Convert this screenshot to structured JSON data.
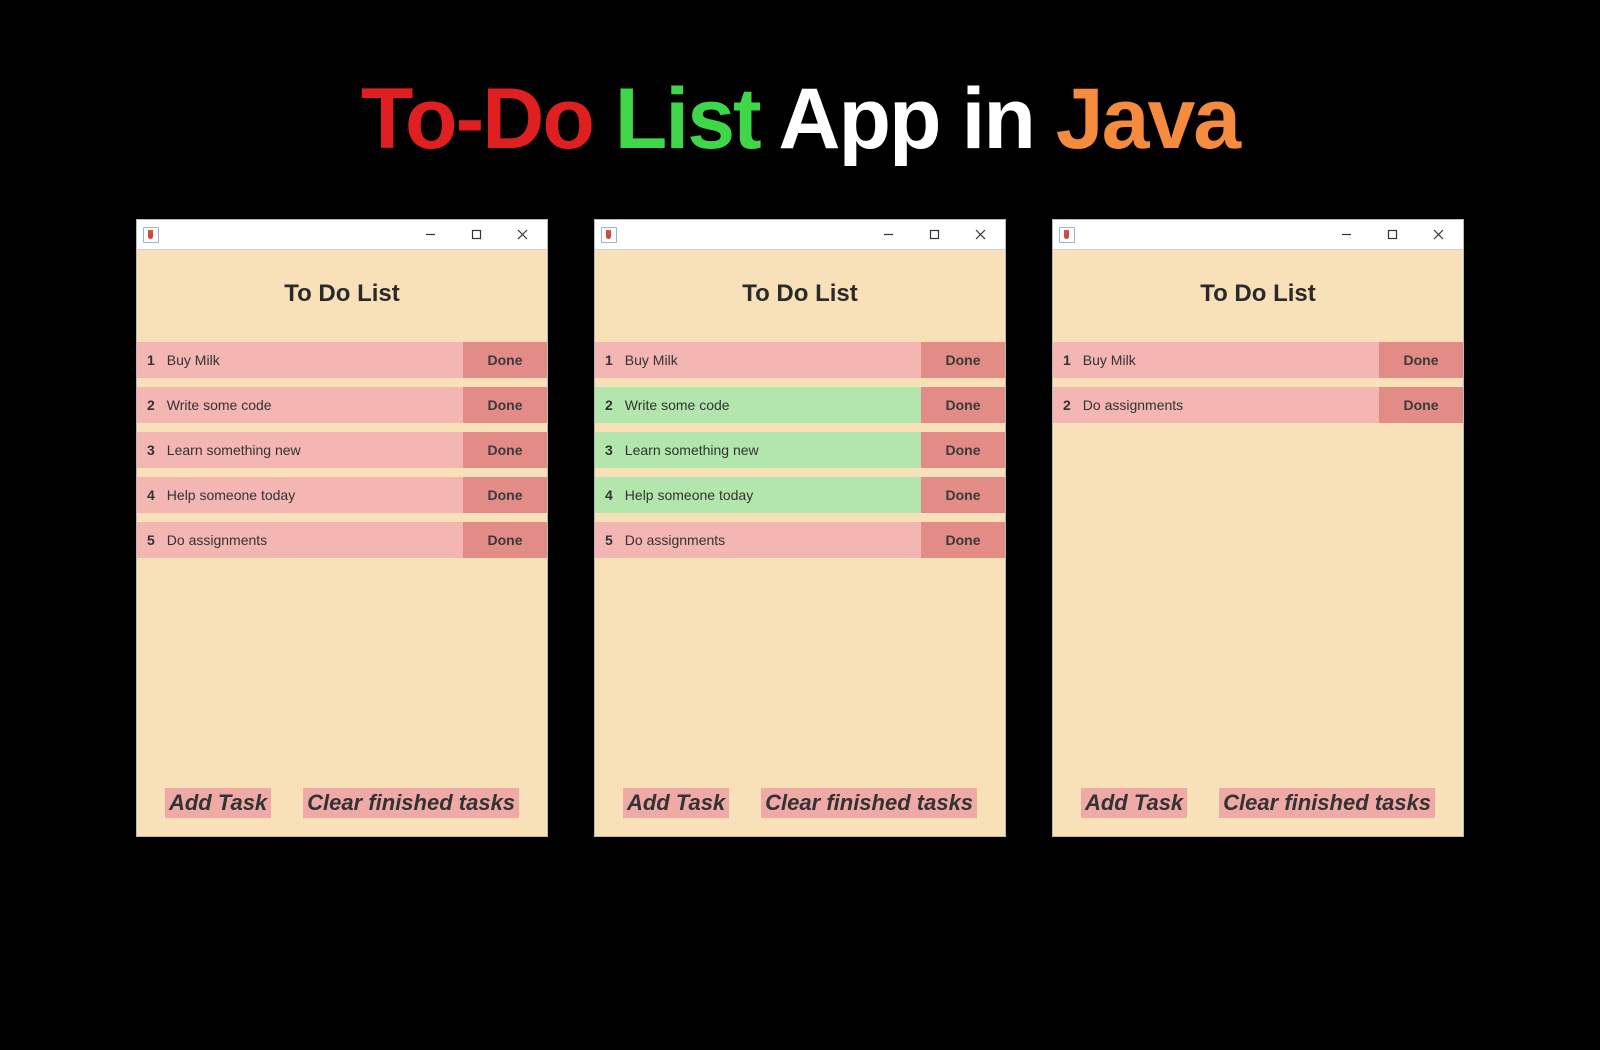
{
  "page_title": {
    "part1": "To-Do",
    "part2": "List",
    "part3": "App in",
    "part4": "Java"
  },
  "colors": {
    "task_pending": "#f3b6b3",
    "task_done_row": "#b3e6ad",
    "done_btn": "#e28b87",
    "footer_btn": "#efa9a6",
    "window_bg": "#f8e1b8"
  },
  "labels": {
    "done": "Done",
    "add_task": "Add Task",
    "clear_finished": "Clear finished tasks",
    "app_title": "To Do List"
  },
  "windows": {
    "left": {
      "title": "To Do List",
      "tasks": [
        {
          "num": "1",
          "text": "Buy Milk",
          "state": "pink"
        },
        {
          "num": "2",
          "text": "Write some code",
          "state": "pink"
        },
        {
          "num": "3",
          "text": "Learn something new",
          "state": "pink"
        },
        {
          "num": "4",
          "text": "Help someone today",
          "state": "pink"
        },
        {
          "num": "5",
          "text": "Do assignments",
          "state": "pink"
        }
      ]
    },
    "mid": {
      "title": "To Do List",
      "tasks": [
        {
          "num": "1",
          "text": "Buy Milk",
          "state": "pink"
        },
        {
          "num": "2",
          "text": "Write some code",
          "state": "green"
        },
        {
          "num": "3",
          "text": "Learn something new",
          "state": "green"
        },
        {
          "num": "4",
          "text": "Help someone today",
          "state": "green"
        },
        {
          "num": "5",
          "text": "Do assignments",
          "state": "pink"
        }
      ]
    },
    "right": {
      "title": "To Do List",
      "tasks": [
        {
          "num": "1",
          "text": "Buy Milk",
          "state": "pink"
        },
        {
          "num": "2",
          "text": "Do assignments",
          "state": "pink"
        }
      ]
    }
  }
}
